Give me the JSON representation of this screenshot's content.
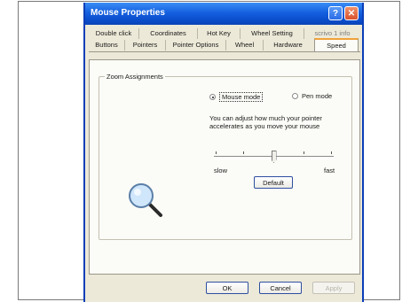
{
  "window": {
    "title": "Mouse Properties"
  },
  "tabs_back": [
    "Double click",
    "Coordinates",
    "Hot Key",
    "Wheel Setting",
    "scrivo 1 info"
  ],
  "tabs_front": [
    "Buttons",
    "Pointers",
    "Pointer Options",
    "Wheel",
    "Hardware",
    "Speed"
  ],
  "active_tab": "Speed",
  "zoom": {
    "group_label": "Zoom Assignments",
    "mouse_mode": "Mouse mode",
    "pen_mode": "Pen mode",
    "selected": "Mouse mode",
    "description": "You can adjust how much your pointer accelerates as you move your mouse",
    "slider_min": "slow",
    "slider_max": "fast",
    "slider_level": 0.5,
    "default_button": "Default"
  },
  "buttons": {
    "ok": "OK",
    "cancel": "Cancel",
    "apply": "Apply"
  },
  "colors": {
    "titlebar": "#0a4cc9",
    "window_bg": "#ece9d8",
    "panel_bg": "#fbfbf7",
    "active_tab_accent": "#f0a23a"
  },
  "icons": {
    "help": "help-icon",
    "close": "close-icon",
    "zoom": "magnifier-icon"
  }
}
